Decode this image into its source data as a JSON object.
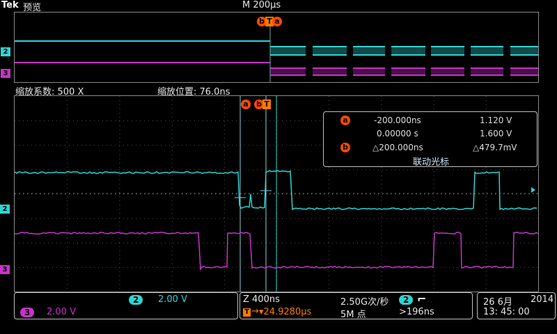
{
  "header": {
    "brand": "Tek",
    "mode": "预览",
    "timebase": "M 200µs"
  },
  "overview": {
    "ch2_marker": "2",
    "ch3_marker": "3"
  },
  "zoom_info": {
    "factor_label": "缩放系数: 500 X",
    "position_label": "缩放位置: 76.0ns"
  },
  "main": {
    "ch2_marker": "2",
    "ch3_marker": "3",
    "cursor_a_label": "a",
    "cursor_b_label": "b",
    "trigger_label": "T"
  },
  "cursor_readout": {
    "a_label": "a",
    "b_label": "b",
    "a_time": "-200.000ns",
    "a_volt": "1.120 V",
    "zero_time": "0.00000 s",
    "zero_volt": "1.600 V",
    "delta_time": "△200.000ns",
    "delta_volt": "△479.7mV",
    "link_label": "联动光标"
  },
  "channels": {
    "ch2_num": "2",
    "ch2_scale": "2.00 V",
    "ch3_num": "3",
    "ch3_scale": "2.00 V"
  },
  "acquisition": {
    "zoom_time": "Z 400ns",
    "sample_rate": "2.50G次/秒",
    "trigger_pos": "▾24.9280µs",
    "trigger_arrow": "→",
    "record_length": "5M 点",
    "trigger_source": "2",
    "trigger_edge": "⌐",
    "trigger_level": ">196ns"
  },
  "datetime": {
    "date_day": "26 6月",
    "year": "2014",
    "time": "13: 45: 00"
  },
  "colors": {
    "ch2": "#2fd3d3",
    "ch3": "#c833c8",
    "cursor": "#ff4a00",
    "trigger": "#ff7a00"
  }
}
